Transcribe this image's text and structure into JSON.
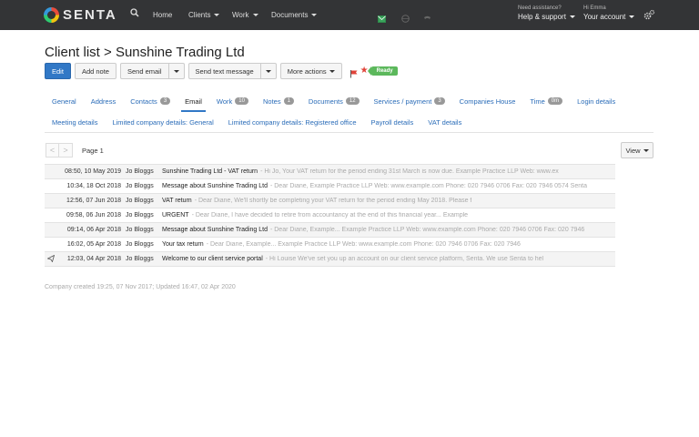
{
  "nav": {
    "brand": "SENTA",
    "links": [
      {
        "label": "Home",
        "caret": false
      },
      {
        "label": "Clients",
        "caret": true
      },
      {
        "label": "Work",
        "caret": true
      },
      {
        "label": "Documents",
        "caret": true
      }
    ],
    "help_small": "Need assistance?",
    "help_label": "Help & support",
    "user_small": "Hi Emma",
    "user_label": "Your account"
  },
  "header": {
    "breadcrumb": "Client list > Sunshine Trading Ltd"
  },
  "toolbar": {
    "edit": "Edit",
    "add_note": "Add note",
    "send_email": "Send email",
    "send_text": "Send text message",
    "more_actions": "More actions",
    "status_badge": "Ready",
    "colors": {
      "primary": "#3178c6",
      "flag": "#e0443a",
      "ready": "#5cb85c"
    }
  },
  "tabs_row1": [
    {
      "label": "General"
    },
    {
      "label": "Address"
    },
    {
      "label": "Contacts",
      "count": "3"
    },
    {
      "label": "Email",
      "active": true
    },
    {
      "label": "Work",
      "count": "10"
    },
    {
      "label": "Notes",
      "count": "1"
    },
    {
      "label": "Documents",
      "count": "12"
    },
    {
      "label": "Services / payment",
      "count": "3"
    },
    {
      "label": "Companies House"
    },
    {
      "label": "Time",
      "count": "0m"
    },
    {
      "label": "Login details"
    }
  ],
  "tabs_row2": [
    {
      "label": "Meeting details"
    },
    {
      "label": "Limited company details: General"
    },
    {
      "label": "Limited company details: Registered office"
    },
    {
      "label": "Payroll details"
    },
    {
      "label": "VAT details"
    }
  ],
  "pager": {
    "prev": "<",
    "next": ">",
    "label": "Page 1"
  },
  "view_button": "View",
  "emails": [
    {
      "icon": "",
      "date": "08:50, 10 May 2019",
      "from": "Jo Bloggs",
      "subject": "Sunshine Trading Ltd - VAT return",
      "preview": "- Hi Jo, Your VAT return for the period ending 31st March is now due. Example Practice LLP Web: www.ex"
    },
    {
      "icon": "",
      "date": "10:34, 18 Oct 2018",
      "from": "Jo Bloggs",
      "subject": "Message about Sunshine Trading Ltd",
      "preview": "- Dear Diane, Example Practice LLP Web: www.example.com Phone: 020 7946 0706 Fax: 020 7946 0574 Senta"
    },
    {
      "icon": "",
      "date": "12:56, 07 Jun 2018",
      "from": "Jo Bloggs",
      "subject": "VAT return",
      "preview": "- Dear Diane, We'll shortly be completing your VAT return for the period ending May 2018. Please f"
    },
    {
      "icon": "",
      "date": "09:58, 06 Jun 2018",
      "from": "Jo Bloggs",
      "subject": "URGENT",
      "preview": "- Dear Diane, I have decided to retire from accountancy at the end of this financial year... Example"
    },
    {
      "icon": "",
      "date": "09:14, 06 Apr 2018",
      "from": "Jo Bloggs",
      "subject": "Message about Sunshine Trading Ltd",
      "preview": "- Dear Diane, Example... Example Practice LLP Web: www.example.com Phone: 020 7946 0706 Fax: 020 7946"
    },
    {
      "icon": "",
      "date": "16:02, 05 Apr 2018",
      "from": "Jo Bloggs",
      "subject": "Your tax return",
      "preview": "- Dear Diane, Example... Example Practice LLP Web: www.example.com Phone: 020 7946 0706 Fax: 020 7946"
    },
    {
      "icon": "paper-plane-icon",
      "date": "12:03, 04 Apr 2018",
      "from": "Jo Bloggs",
      "subject": "Welcome to our client service portal",
      "preview": "- Hi Louise We've set you up an account on our client service platform, Senta. We use Senta to hel"
    }
  ],
  "footer": "Company created 19:25, 07 Nov 2017; Updated 16:47, 02 Apr 2020"
}
